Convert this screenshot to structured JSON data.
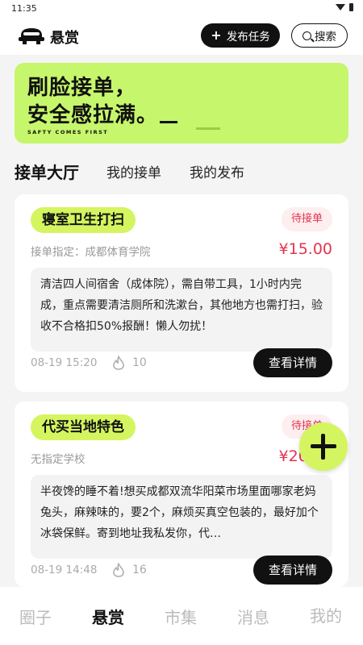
{
  "status_bar": {
    "time": "11:35",
    "icons": [
      "wifi-icon",
      "battery-icon"
    ]
  },
  "header": {
    "title": "悬赏",
    "publish_label": "发布任务",
    "search_label": "搜索"
  },
  "banner": {
    "line1": "刷脸接单，",
    "line2": "安全感拉满。",
    "subtitle": "SAFTY COMES FIRST",
    "accent_color": "#c6f66b"
  },
  "tabs": [
    {
      "label": "接单大厅",
      "active": true
    },
    {
      "label": "我的接单",
      "active": false
    },
    {
      "label": "我的发布",
      "active": false
    }
  ],
  "tasks": [
    {
      "title": "寝室卫生打扫",
      "status": "待接单",
      "assign": "接单指定：成都体育学院",
      "price": "¥15.00",
      "description": "清洁四人间宿舍（成体院），需自带工具，1小时内完成，重点需要清洁厕所和洗漱台，其他地方也需打扫，验收不合格扣50%报酬！懒人勿扰！",
      "time": "08-19 15:20",
      "heat": "10",
      "detail_label": "查看详情"
    },
    {
      "title": "代买当地特色",
      "status": "待接单",
      "assign": "无指定学校",
      "price": "¥20.00",
      "description": "半夜馋的睡不着!想买成都双流华阳菜市场里面哪家老妈兔头，麻辣味的，要2个，麻烦买真空包装的，最好加个冰袋保鲜。寄到地址我私发你，代…",
      "time": "08-19 14:48",
      "heat": "16",
      "detail_label": "查看详情"
    }
  ],
  "colors": {
    "accent": "#d4f55f",
    "price": "#e3344f",
    "badge_bg": "#fdeeef"
  },
  "bottom_nav": [
    {
      "label": "圈子",
      "active": false
    },
    {
      "label": "悬赏",
      "active": true
    },
    {
      "label": "市集",
      "active": false
    },
    {
      "label": "消息",
      "active": false
    },
    {
      "label": "我的",
      "active": false
    }
  ]
}
